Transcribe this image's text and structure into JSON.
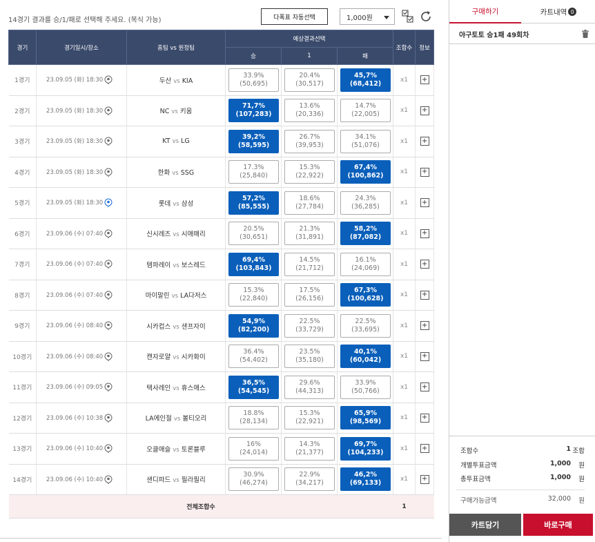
{
  "topbar": {
    "instruction": "14경기 결과를 승/1/패로 선택해 주세요. (복식 가능)",
    "auto_select_label": "다폭표 자동선택",
    "amount_value": "1,000원"
  },
  "table": {
    "headers": {
      "game": "경기",
      "datetime": "경기일시/장소",
      "teams_home": "홈팀",
      "teams_vs": "vs",
      "teams_away": "원정팀",
      "prediction": "예상결과선택",
      "win": "승",
      "draw": "1",
      "lose": "패",
      "combos": "조합수",
      "info": "정보"
    },
    "rows": [
      {
        "game": "1경기",
        "datetime": "23.09.05 (화) 18:30",
        "home": "두산",
        "away": "KIA",
        "win_pct": "33.9%",
        "win_cnt": "(50,695)",
        "draw_pct": "20.4%",
        "draw_cnt": "(30,517)",
        "lose_pct": "45,7%",
        "lose_cnt": "(68,412)",
        "selected": "lose",
        "mult": "x1",
        "pin": "normal"
      },
      {
        "game": "2경기",
        "datetime": "23.09.05 (화) 18:30",
        "home": "NC",
        "away": "키움",
        "win_pct": "71,7%",
        "win_cnt": "(107,283)",
        "draw_pct": "13.6%",
        "draw_cnt": "(20,336)",
        "lose_pct": "14.7%",
        "lose_cnt": "(22,005)",
        "selected": "win",
        "mult": "x1",
        "pin": "normal"
      },
      {
        "game": "3경기",
        "datetime": "23.09.05 (화) 18:30",
        "home": "KT",
        "away": "LG",
        "win_pct": "39,2%",
        "win_cnt": "(58,595)",
        "draw_pct": "26.7%",
        "draw_cnt": "(39,953)",
        "lose_pct": "34.1%",
        "lose_cnt": "(51,076)",
        "selected": "win",
        "mult": "x1",
        "pin": "normal"
      },
      {
        "game": "4경기",
        "datetime": "23.09.05 (화) 18:30",
        "home": "한화",
        "away": "SSG",
        "win_pct": "17.3%",
        "win_cnt": "(25,840)",
        "draw_pct": "15.3%",
        "draw_cnt": "(22,922)",
        "lose_pct": "67,4%",
        "lose_cnt": "(100,862)",
        "selected": "lose",
        "mult": "x1",
        "pin": "normal"
      },
      {
        "game": "5경기",
        "datetime": "23.09.05 (화) 18:30",
        "home": "롯데",
        "away": "삼성",
        "win_pct": "57,2%",
        "win_cnt": "(85,555)",
        "draw_pct": "18.6%",
        "draw_cnt": "(27,784)",
        "lose_pct": "24.3%",
        "lose_cnt": "(36,285)",
        "selected": "win",
        "mult": "x1",
        "pin": "blue"
      },
      {
        "game": "6경기",
        "datetime": "23.09.06 (수) 07:40",
        "home": "신시레즈",
        "away": "시애매리",
        "win_pct": "20.5%",
        "win_cnt": "(30,651)",
        "draw_pct": "21.3%",
        "draw_cnt": "(31,891)",
        "lose_pct": "58,2%",
        "lose_cnt": "(87,082)",
        "selected": "lose",
        "mult": "x1",
        "pin": "normal"
      },
      {
        "game": "7경기",
        "datetime": "23.09.06 (수) 07:40",
        "home": "템파레이",
        "away": "보스레드",
        "win_pct": "69,4%",
        "win_cnt": "(103,843)",
        "draw_pct": "14.5%",
        "draw_cnt": "(21,712)",
        "lose_pct": "16.1%",
        "lose_cnt": "(24,069)",
        "selected": "win",
        "mult": "x1",
        "pin": "normal"
      },
      {
        "game": "8경기",
        "datetime": "23.09.06 (수) 07:40",
        "home": "마이말린",
        "away": "LA다저스",
        "win_pct": "15.3%",
        "win_cnt": "(22,840)",
        "draw_pct": "17.5%",
        "draw_cnt": "(26,156)",
        "lose_pct": "67,3%",
        "lose_cnt": "(100,628)",
        "selected": "lose",
        "mult": "x1",
        "pin": "normal"
      },
      {
        "game": "9경기",
        "datetime": "23.09.06 (수) 08:40",
        "home": "시카컵스",
        "away": "샌프자이",
        "win_pct": "54,9%",
        "win_cnt": "(82,200)",
        "draw_pct": "22.5%",
        "draw_cnt": "(33,729)",
        "lose_pct": "22.5%",
        "lose_cnt": "(33,695)",
        "selected": "win",
        "mult": "x1",
        "pin": "normal"
      },
      {
        "game": "10경기",
        "datetime": "23.09.06 (수) 08:40",
        "home": "캔자로얄",
        "away": "시카화이",
        "win_pct": "36.4%",
        "win_cnt": "(54,402)",
        "draw_pct": "23.5%",
        "draw_cnt": "(35,180)",
        "lose_pct": "40,1%",
        "lose_cnt": "(60,042)",
        "selected": "lose",
        "mult": "x1",
        "pin": "normal"
      },
      {
        "game": "11경기",
        "datetime": "23.09.06 (수) 09:05",
        "home": "텍사레인",
        "away": "휴스애스",
        "win_pct": "36,5%",
        "win_cnt": "(54,545)",
        "draw_pct": "29.6%",
        "draw_cnt": "(44,313)",
        "lose_pct": "33.9%",
        "lose_cnt": "(50,766)",
        "selected": "win",
        "mult": "x1",
        "pin": "normal"
      },
      {
        "game": "12경기",
        "datetime": "23.09.06 (수) 10:38",
        "home": "LA에인절",
        "away": "볼티오리",
        "win_pct": "18.8%",
        "win_cnt": "(28,134)",
        "draw_pct": "15.3%",
        "draw_cnt": "(22,921)",
        "lose_pct": "65,9%",
        "lose_cnt": "(98,569)",
        "selected": "lose",
        "mult": "x1",
        "pin": "normal"
      },
      {
        "game": "13경기",
        "datetime": "23.09.06 (수) 10:40",
        "home": "오클애슬",
        "away": "토론블루",
        "win_pct": "16%",
        "win_cnt": "(24,014)",
        "draw_pct": "14.3%",
        "draw_cnt": "(21,377)",
        "lose_pct": "69,7%",
        "lose_cnt": "(104,233)",
        "selected": "lose",
        "mult": "x1",
        "pin": "normal"
      },
      {
        "game": "14경기",
        "datetime": "23.09.06 (수) 10:40",
        "home": "샌디파드",
        "away": "필라필리",
        "win_pct": "30.9%",
        "win_cnt": "(46,274)",
        "draw_pct": "22.9%",
        "draw_cnt": "(34,217)",
        "lose_pct": "46,2%",
        "lose_cnt": "(69,133)",
        "selected": "lose",
        "mult": "x1",
        "pin": "normal"
      }
    ],
    "footer": {
      "label": "전체조합수",
      "total": "1"
    }
  },
  "sidebar": {
    "tab_buy": "구매하기",
    "tab_cart": "카트내역",
    "cart_count": "0",
    "slip_name": "야구토토 승1패 49회차",
    "summary": {
      "combos_label": "조합수",
      "combos_value": "1",
      "combos_unit": "조합",
      "each_label": "개별투표금액",
      "each_value": "1,000",
      "each_unit": "원",
      "total_label": "총투표금액",
      "total_value": "1,000",
      "total_unit": "원",
      "avail_label": "구매가능금액",
      "avail_value": "32,000",
      "avail_unit": "원"
    },
    "cart_button": "카트담기",
    "buy_button": "바로구매"
  },
  "colors": {
    "header_bg": "#3a4a6b",
    "selected_blue": "#0a5fba",
    "accent_red": "#c8102e",
    "footer_pink": "#fbeeee"
  }
}
